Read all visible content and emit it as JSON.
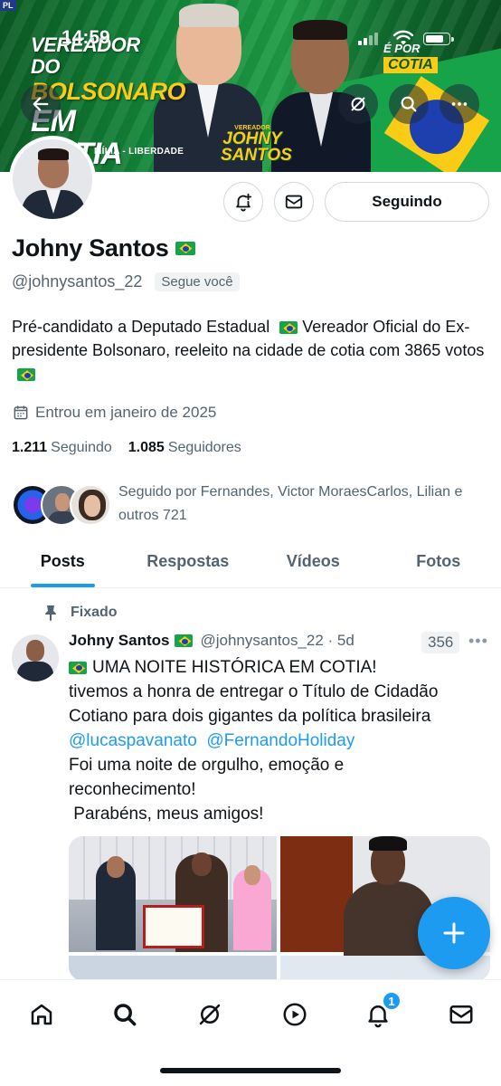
{
  "status_bar": {
    "time": "14:59"
  },
  "banner": {
    "corner_tag": "PL",
    "title_line1": "VEREADOR DO",
    "title_line2": "BOLSONARO",
    "title_line3": "EM COTIA",
    "tagline": "MÍLIA - LIBERDADE",
    "logo_small": "VEREADOR",
    "logo_name": "JOHNY SANTOS",
    "badge_top": "É POR",
    "badge_bottom": "COTIA"
  },
  "header_buttons": {
    "back_icon": "arrow-left-icon",
    "grok_icon": "grok-icon",
    "search_icon": "search-icon",
    "more_icon": "more-icon",
    "more_label": "•••"
  },
  "profile": {
    "name": "Johny Santos",
    "handle": "@johnysantos_22",
    "follows_you": "Segue você",
    "bio": "Pré-candidato a Deputado Estadual 🇧🇷 Vereador Oficial do Ex-presidente Bolsonaro, reeleito na cidade de cotia com 3865 votos 🇧🇷",
    "bio_part1": "Pré-candidato a Deputado Estadual",
    "bio_part2": "Vereador Oficial do Ex-presidente Bolsonaro, reeleito na cidade de cotia com 3865 votos",
    "joined": "Entrou em janeiro de 2025",
    "following_count": "1.211",
    "following_label": "Seguindo",
    "followers_count": "1.085",
    "followers_label": "Seguidores",
    "followed_by": "Seguido por Fernandes, Victor MoraesCarlos, Lilian e outros 721"
  },
  "actions": {
    "following_button": "Seguindo"
  },
  "tabs": [
    {
      "label": "Posts",
      "active": true
    },
    {
      "label": "Respostas",
      "active": false
    },
    {
      "label": "Vídeos",
      "active": false
    },
    {
      "label": "Fotos",
      "active": false
    }
  ],
  "pinned_post": {
    "pinned_label": "Fixado",
    "author_name": "Johny Santos",
    "author_handle": "@johnysantos_22 · 5d",
    "views": "356",
    "more": "•••",
    "text_line1": "UMA NOITE HISTÓRICA EM COTIA!",
    "text_line2": "tivemos a honra de entregar o Título de Cidadão",
    "text_line3": "Cotiano para dois gigantes da política brasileira",
    "mention1": "@lucaspavanato",
    "mention2": "@FernandoHoliday",
    "text_line5": "Foi uma noite de orgulho, emoção e",
    "text_line6": "reconhecimento!",
    "text_line7": " Parabéns, meus amigos!"
  },
  "compose_button": {
    "icon": "plus-icon",
    "label": "+"
  },
  "bottom_nav": {
    "items": [
      "home-icon",
      "search-icon",
      "grok-icon",
      "video-icon",
      "bell-icon",
      "mail-icon"
    ],
    "notification_count": "1"
  },
  "colors": {
    "accent": "#1d9bf0",
    "text_primary": "#0f1419",
    "text_secondary": "#536471",
    "banner_green": "#138a3a",
    "banner_yellow": "#facc15"
  }
}
